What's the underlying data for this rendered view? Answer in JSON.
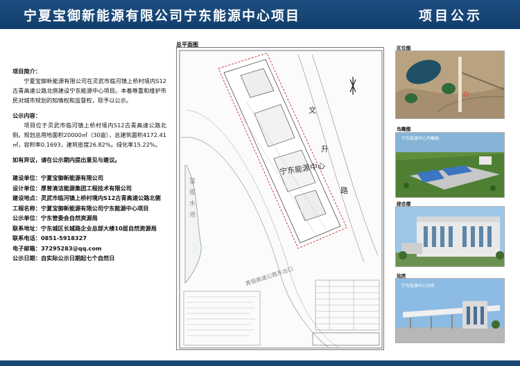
{
  "header": {
    "title": "宁夏宝御新能源有限公司宁东能源中心项目",
    "notice": "项目公示",
    "bg_color": "#1d4e80",
    "text_color": "#ffffff"
  },
  "left_panel": {
    "intro_heading": "项目简介：",
    "intro_text": "宁夏宝御新能源有限公司在灵武市临河镇上桥村境内S12古青高速公路北侧建设宁东能源中心项目。本着尊重和维护市民对城市规划的知情权和监督权，现予以公示。",
    "content_heading": "公示内容：",
    "content_text": "项目位于灵武市临河镇上桥村境内S12古青高速公路北侧。规划总用地面积20000㎡（30亩），总建筑面积4172.41㎡，容积率0.1693，建筑密度26.82%。绿化率15.22%。",
    "objection_text": "如有异议，请在公示期内提出意见与建议。",
    "info": [
      {
        "label": "建设单位：",
        "value": "宁夏宝御新能源有限公司"
      },
      {
        "label": "设计单位：",
        "value": "厚普清洁能源集团工程技术有限公司"
      },
      {
        "label": "建设地点：",
        "value": "灵武市临河镇上桥村境内S12古青高速公路北侧"
      },
      {
        "label": "工程名称：",
        "value": "宁夏宝御新能源有限公司宁东能源中心项目"
      },
      {
        "label": "公示单位：",
        "value": "宁东管委会自然资源局"
      },
      {
        "label": "联系地址：",
        "value": "宁东城区长城路企业总部大楼10层自然资源局"
      },
      {
        "label": "联系电话：",
        "value": "0851-5918327"
      },
      {
        "label": "电子邮箱：",
        "value": "37295283@qq.com"
      },
      {
        "label": "公示日期：",
        "value": "自实际公示日期起七个自然日"
      }
    ]
  },
  "plan": {
    "label": "总平面图",
    "center_label": "宁东能源中心",
    "road_label_chars": [
      "文",
      "升",
      "路"
    ],
    "pond_label_chars": [
      "景",
      "观",
      "水",
      "池"
    ],
    "highway_label": "青银高速公路东出口"
  },
  "right_panel": {
    "location_label": "区位图",
    "aerial_label": "鸟瞰图",
    "office_label": "综合楼",
    "station_label": "站房",
    "render_caption_1": "宁东能源中心鸟瞰图",
    "render_caption_2": "宁东能源中心站房"
  }
}
